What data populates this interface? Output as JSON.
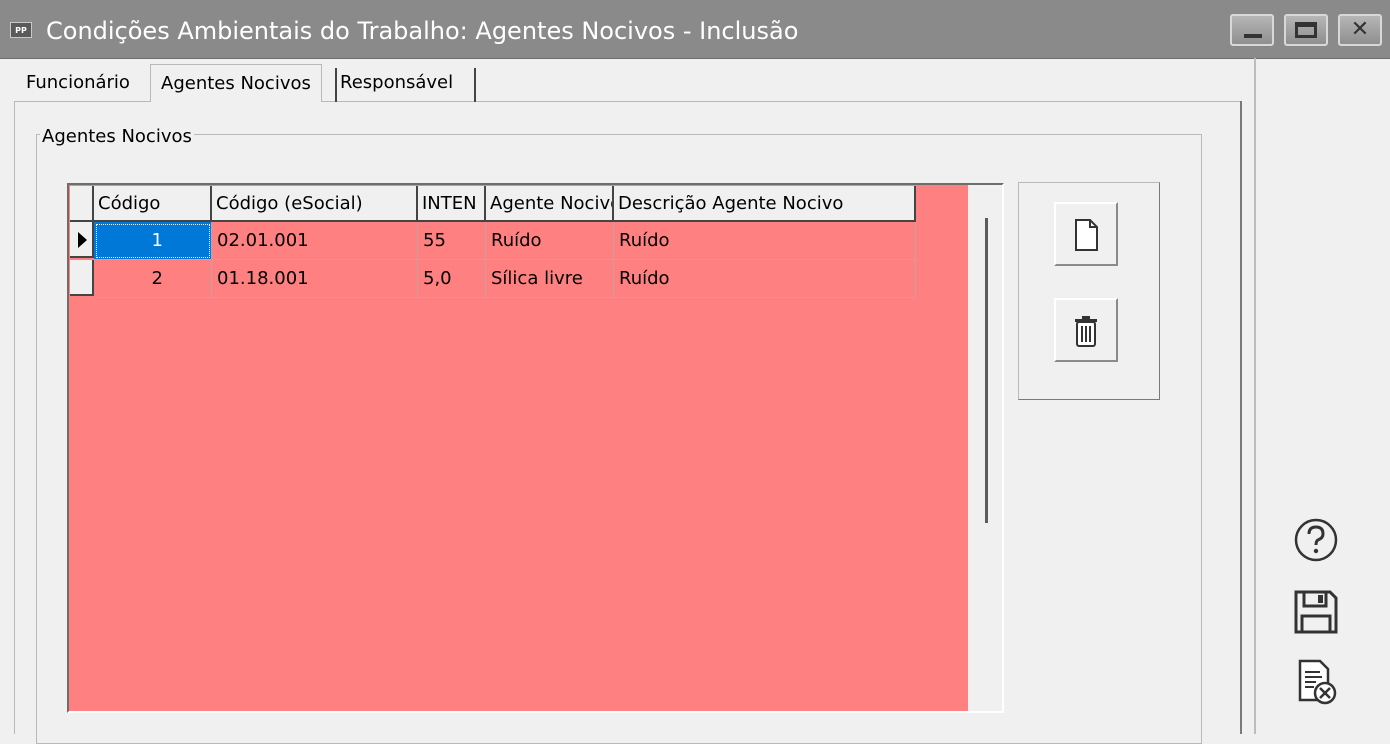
{
  "window": {
    "app_icon_text": "PP",
    "title": "Condições Ambientais do Trabalho: Agentes Nocivos - Inclusão"
  },
  "tabs": [
    {
      "label": "Funcionário",
      "active": false
    },
    {
      "label": "Agentes Nocivos",
      "active": true
    },
    {
      "label": "Responsável",
      "active": false
    }
  ],
  "group": {
    "title": "Agentes Nocivos"
  },
  "grid": {
    "background_color": "#ff8080",
    "selection_color": "#0078d7",
    "columns": [
      "Código",
      "Código (eSocial)",
      "INTEN",
      "Agente Nocivo",
      "Descrição Agente Nocivo"
    ],
    "rows": [
      {
        "codigo": "1",
        "codigo_esocial": "02.01.001",
        "intensidade": "55",
        "agente": "Ruído",
        "descricao": "Ruído",
        "current": true
      },
      {
        "codigo": "2",
        "codigo_esocial": "01.18.001",
        "intensidade": "5,0",
        "agente": "Sílica livre",
        "descricao": "Ruído",
        "current": false
      }
    ]
  },
  "actions": {
    "new_icon": "new-document-icon",
    "delete_icon": "trash-icon"
  },
  "side_actions": {
    "help_icon": "help-icon",
    "save_icon": "save-icon",
    "cancel_icon": "cancel-document-icon"
  }
}
